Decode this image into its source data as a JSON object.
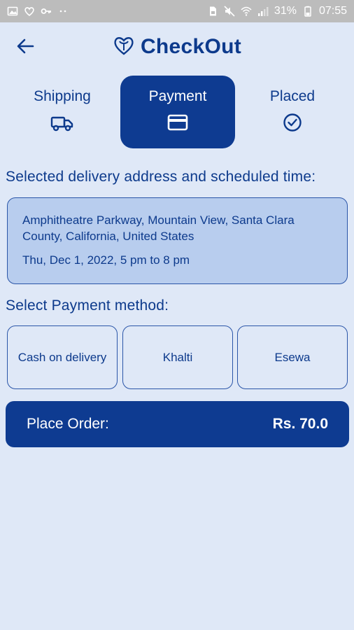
{
  "status_bar": {
    "battery": "31%",
    "time": "07:55",
    "left_icons": [
      "image-icon",
      "logo-small-icon",
      "key-icon",
      "dots-icon"
    ],
    "right_icons": [
      "sim-icon",
      "mute-icon",
      "wifi-icon",
      "signal-icon",
      "battery-icon"
    ]
  },
  "header": {
    "title": "CheckOut",
    "back_icon": "arrow-left-icon",
    "logo_icon": "hearts-logo-icon"
  },
  "steps": [
    {
      "label": "Shipping",
      "icon": "truck-icon",
      "active": false
    },
    {
      "label": "Payment",
      "icon": "card-icon",
      "active": true
    },
    {
      "label": "Placed",
      "icon": "check-circle-icon",
      "active": false
    }
  ],
  "delivery": {
    "heading": "Selected delivery address and scheduled time:",
    "address": "Amphitheatre Parkway, Mountain View, Santa Clara County, California, United States",
    "schedule": "Thu, Dec 1, 2022, 5 pm to 8 pm"
  },
  "payment": {
    "heading": "Select Payment method:",
    "options": [
      "Cash on delivery",
      "Khalti",
      "Esewa"
    ]
  },
  "place_order": {
    "label": "Place Order:",
    "amount": "Rs. 70.0"
  },
  "colors": {
    "primary": "#0e3b91",
    "background": "#dfe8f7",
    "card": "#b8cdee",
    "status_bar": "#bcbcbc"
  }
}
